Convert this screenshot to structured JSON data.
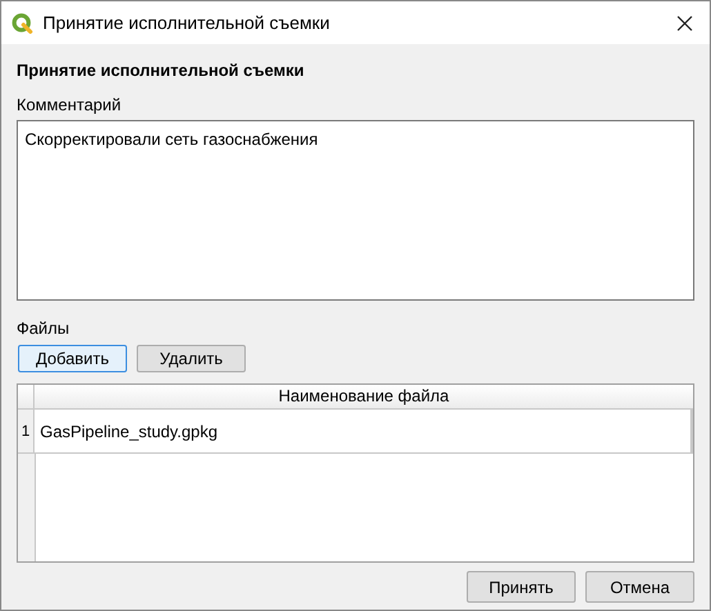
{
  "window": {
    "title": "Принятие исполнительной съемки"
  },
  "heading": "Принятие исполнительной съемки",
  "comment": {
    "label": "Комментарий",
    "value": "Скорректировали сеть газоснабжения"
  },
  "files": {
    "label": "Файлы",
    "buttons": [
      {
        "label": "Добавить",
        "focused": true
      },
      {
        "label": "Удалить",
        "focused": false
      }
    ],
    "table": {
      "columns": [
        "Наименование файла"
      ],
      "rows": [
        {
          "number": "1",
          "name": "GasPipeline_study.gpkg"
        }
      ]
    }
  },
  "buttons": [
    {
      "label": "Принять"
    },
    {
      "label": "Отмена"
    }
  ]
}
